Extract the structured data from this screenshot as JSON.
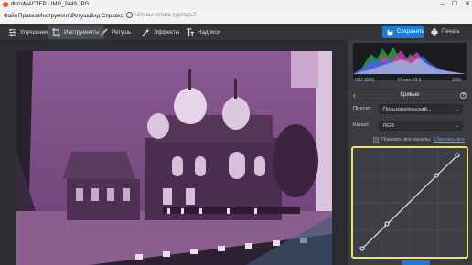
{
  "window": {
    "title": "ФотоМАСТЕР - IMG_2449.JPG",
    "controls": [
      "–",
      "☐",
      "✕"
    ]
  },
  "menu": {
    "items": [
      "Файл",
      "Правка",
      "Инструменты",
      "Ретушь",
      "Вид",
      "Справка"
    ],
    "search_placeholder": "Что вы хотите сделать?"
  },
  "toolbar": {
    "tabs": [
      {
        "label": "Улучшения",
        "icon": "sliders-icon",
        "active": false
      },
      {
        "label": "Инструменты",
        "icon": "crop-icon",
        "active": true
      },
      {
        "label": "Ретушь",
        "icon": "brush-icon",
        "active": false
      },
      {
        "label": "Эффекты",
        "icon": "magic-wand-icon",
        "active": false
      },
      {
        "label": "Надписи",
        "icon": "text-icon",
        "active": false
      }
    ],
    "save_label": "Сохранить",
    "print_label": "Печать"
  },
  "histogram": {
    "iso": "ISO 3200",
    "lens": "47 mm f/3.6",
    "shutter": "1/30"
  },
  "curves_panel": {
    "title": "Кривые",
    "preset_label": "Пресет:",
    "preset_value": "Пользовательский...",
    "channel_label": "Канал:",
    "channel_value": "RGB",
    "show_all_channels": "Показать все каналы",
    "reset_all": "Сбросить все"
  },
  "colors": {
    "accent_blue": "#1f7ad1",
    "curve_highlight": "#efe36a",
    "photo_tint": "#7a4a82"
  }
}
